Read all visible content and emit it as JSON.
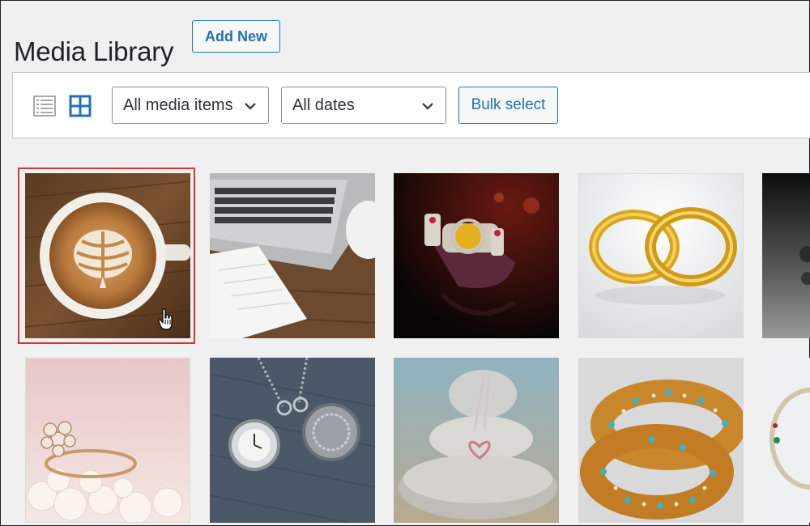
{
  "page": {
    "title": "Media Library",
    "add_new_label": "Add New"
  },
  "toolbar": {
    "view_modes": [
      "list-view-icon",
      "grid-view-icon"
    ],
    "active_view": "grid",
    "media_filter": "All media items",
    "date_filter": "All dates",
    "bulk_select_label": "Bulk select"
  },
  "colors": {
    "accent": "#2271b1",
    "selection": "#d63638",
    "background": "#f0f0f1"
  },
  "grid": {
    "selected_index": 0,
    "items": [
      {
        "subject": "latte-art-coffee-cup"
      },
      {
        "subject": "laptop-and-notebook"
      },
      {
        "subject": "jeweled-bracelet-watch"
      },
      {
        "subject": "gold-wedding-rings"
      },
      {
        "subject": "dark-jewelry-partial"
      },
      {
        "subject": "flower-ring-on-pearls"
      },
      {
        "subject": "pocket-watch-pendants"
      },
      {
        "subject": "heart-pendant-on-stones"
      },
      {
        "subject": "ornate-gold-bangles"
      },
      {
        "subject": "bangle-partial"
      }
    ]
  }
}
